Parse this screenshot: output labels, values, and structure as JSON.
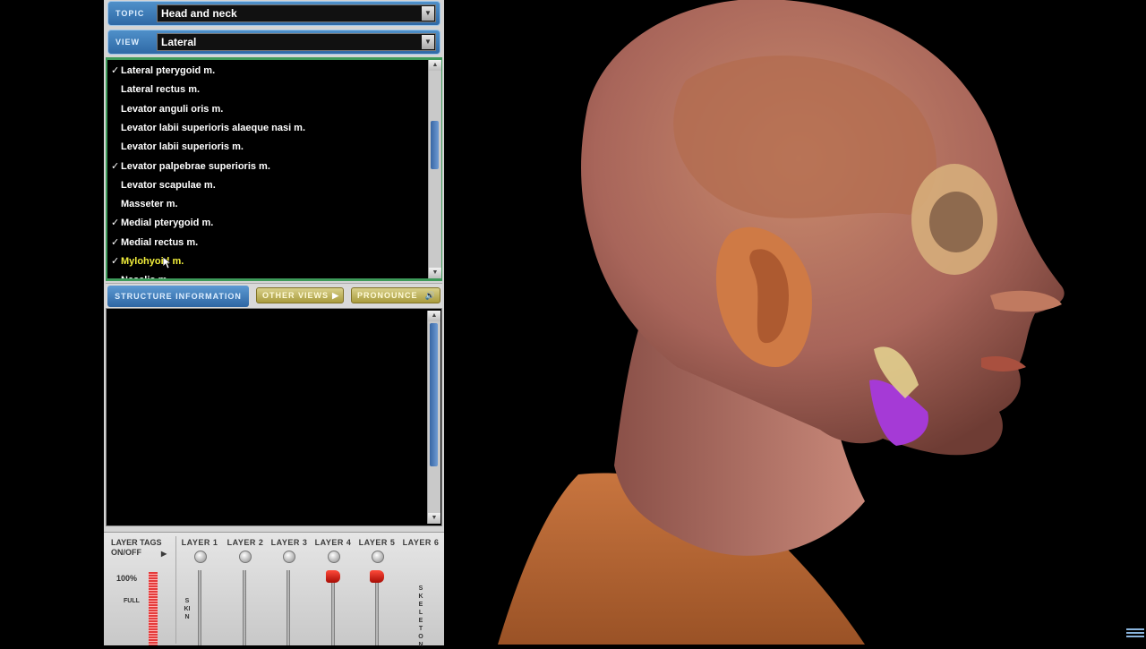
{
  "topic": {
    "label": "TOPIC",
    "value": "Head and neck"
  },
  "view": {
    "label": "VIEW",
    "value": "Lateral"
  },
  "structures": [
    {
      "name": "Lateral pterygoid m.",
      "checked": true,
      "selected": false
    },
    {
      "name": "Lateral rectus m.",
      "checked": false,
      "selected": false
    },
    {
      "name": "Levator anguli oris m.",
      "checked": false,
      "selected": false
    },
    {
      "name": "Levator labii superioris alaeque nasi m.",
      "checked": false,
      "selected": false
    },
    {
      "name": "Levator labii superioris m.",
      "checked": false,
      "selected": false
    },
    {
      "name": "Levator palpebrae superioris m.",
      "checked": true,
      "selected": false
    },
    {
      "name": "Levator scapulae m.",
      "checked": false,
      "selected": false
    },
    {
      "name": "Masseter m.",
      "checked": false,
      "selected": false
    },
    {
      "name": "Medial pterygoid m.",
      "checked": true,
      "selected": false
    },
    {
      "name": "Medial rectus m.",
      "checked": true,
      "selected": false
    },
    {
      "name": "Mylohyoid m.",
      "checked": true,
      "selected": true
    },
    {
      "name": "Nasalis m.",
      "checked": false,
      "selected": false
    }
  ],
  "check_mark": "✓",
  "info_bar": {
    "tab": "STRUCTURE INFORMATION",
    "other_views": "OTHER VIEWS",
    "pronounce": "PRONOUNCE"
  },
  "layers": {
    "tags_label": "LAYER TAGS ON/OFF",
    "percent": "100%",
    "full_label": "FULL",
    "headers": [
      "LAYER 1",
      "LAYER 2",
      "LAYER 3",
      "LAYER 4",
      "LAYER 5",
      "LAYER 6"
    ],
    "layer1_side": "SKIN",
    "layer6_side": "SKELETON",
    "active": [
      false,
      false,
      false,
      true,
      true,
      false
    ]
  },
  "icons": {
    "dropdown": "chevron-down-icon",
    "play": "play-icon",
    "speaker": "speaker-icon",
    "tags_toggle": "triangle-right-icon"
  },
  "colors": {
    "header_blue": "#3f7dbb",
    "list_border_green": "#3d9a59",
    "selected_text": "#f2ef3b",
    "highlight_muscle": "#a53ad6"
  }
}
